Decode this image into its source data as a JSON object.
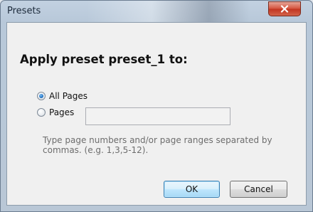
{
  "window": {
    "title": "Presets"
  },
  "dialog": {
    "heading": "Apply preset preset_1 to:",
    "options": [
      {
        "label": "All Pages",
        "selected": true
      },
      {
        "label": "Pages",
        "selected": false
      }
    ],
    "pages_input": {
      "value": "",
      "placeholder": ""
    },
    "hint": "Type page numbers and/or page ranges separated by commas.  (e.g. 1,3,5-12).",
    "buttons": {
      "ok": "OK",
      "cancel": "Cancel"
    }
  },
  "icons": {
    "close": "close-icon"
  },
  "colors": {
    "close_button": "#c7402a",
    "radio_selected": "#2b79c6",
    "default_button_border": "#3c7fb1"
  }
}
